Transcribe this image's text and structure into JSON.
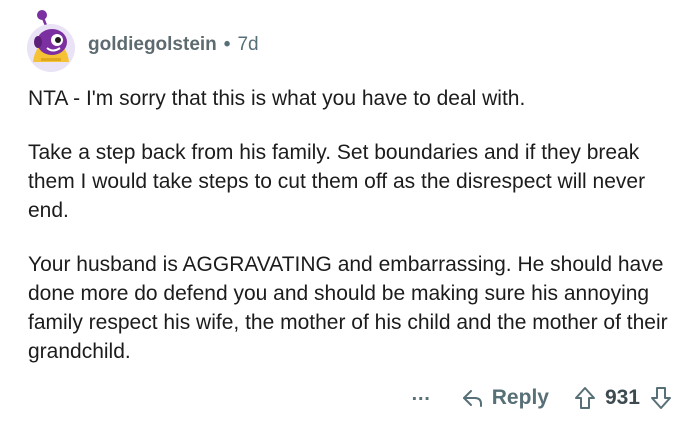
{
  "comment": {
    "username": "goldiegolstein",
    "separator": "•",
    "time": "7d",
    "paragraphs": [
      "NTA - I'm sorry that this is what you have to deal with.",
      "Take a step back from his family. Set boundaries and if they break them I would take steps to cut them off as the disrespect will never end.",
      "Your husband is AGGRAVATING and embarrassing. He should have done more do defend you and should be making sure his annoying family respect his wife, the mother of his child and the mother of their grandchild."
    ],
    "actions": {
      "more_label": "…",
      "reply_label": "Reply",
      "vote_count": "931"
    },
    "icons": {
      "avatar": "avatar-icon",
      "more": "more-options-icon",
      "reply": "reply-arrow-icon",
      "upvote": "upvote-arrow-icon",
      "downvote": "downvote-arrow-icon"
    },
    "colors": {
      "meta_text": "#576f76",
      "body_text": "#1c1c1c",
      "avatar_purple": "#7b2fa0",
      "avatar_yellow": "#f6c235",
      "avatar_bg": "#e9e3f5"
    }
  }
}
